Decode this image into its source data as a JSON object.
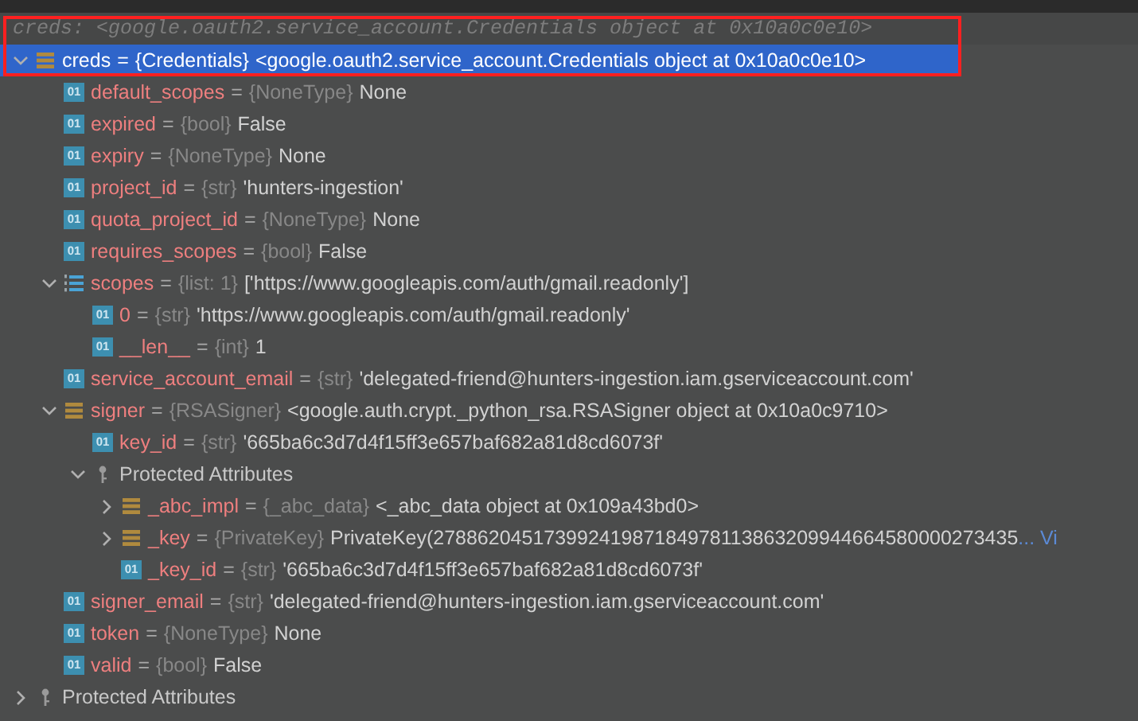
{
  "hint": "creds: <google.oauth2.service_account.Credentials object at 0x10a0c0e10>",
  "separator": "=",
  "tree": [
    {
      "kind": "object",
      "name": "creds",
      "type": "{Credentials}",
      "value": "<google.oauth2.service_account.Credentials object at 0x10a0c0e10>",
      "expanded": true,
      "selected": true,
      "children": [
        {
          "kind": "field",
          "badge": "01",
          "name": "default_scopes",
          "type": "{NoneType}",
          "value": "None",
          "selected": false
        },
        {
          "kind": "field",
          "badge": "01",
          "name": "expired",
          "type": "{bool}",
          "value": "False",
          "selected": false
        },
        {
          "kind": "field",
          "badge": "01",
          "name": "expiry",
          "type": "{NoneType}",
          "value": "None",
          "selected": false
        },
        {
          "kind": "field",
          "badge": "01",
          "name": "project_id",
          "type": "{str}",
          "value": "'hunters-ingestion'",
          "selected": false
        },
        {
          "kind": "field",
          "badge": "01",
          "name": "quota_project_id",
          "type": "{NoneType}",
          "value": "None",
          "selected": false
        },
        {
          "kind": "field",
          "badge": "01",
          "name": "requires_scopes",
          "type": "{bool}",
          "value": "False",
          "selected": false
        },
        {
          "kind": "list",
          "name": "scopes",
          "type": "{list: 1}",
          "value": "['https://www.googleapis.com/auth/gmail.readonly']",
          "expanded": true,
          "selected": false,
          "children": [
            {
              "kind": "field",
              "badge": "01",
              "name": "0",
              "type": "{str}",
              "value": "'https://www.googleapis.com/auth/gmail.readonly'",
              "selected": false
            },
            {
              "kind": "field",
              "badge": "01",
              "name": "__len__",
              "type": "{int}",
              "value": "1",
              "selected": false
            }
          ]
        },
        {
          "kind": "field",
          "badge": "01",
          "name": "service_account_email",
          "type": "{str}",
          "value": "'delegated-friend@hunters-ingestion.iam.gserviceaccount.com'",
          "selected": false
        },
        {
          "kind": "object",
          "name": "signer",
          "type": "{RSASigner}",
          "value": "<google.auth.crypt._python_rsa.RSASigner object at 0x10a0c9710>",
          "expanded": true,
          "selected": false,
          "children": [
            {
              "kind": "field",
              "badge": "01",
              "name": "key_id",
              "type": "{str}",
              "value": "'665ba6c3d7d4f15ff3e657baf682a81d8cd6073f'",
              "selected": false
            },
            {
              "kind": "group",
              "name": "Protected Attributes",
              "expanded": true,
              "selected": false,
              "children": [
                {
                  "kind": "object",
                  "name": "_abc_impl",
                  "type": "{_abc_data}",
                  "value": "<_abc_data object at 0x109a43bd0>",
                  "expanded": false,
                  "selected": false
                },
                {
                  "kind": "object",
                  "name": "_key",
                  "type": "{PrivateKey}",
                  "value": "PrivateKey(27886204517399241987184978113863209944664580000273435",
                  "link": "... Vi",
                  "expanded": false,
                  "selected": false
                },
                {
                  "kind": "field",
                  "badge": "01",
                  "name": "_key_id",
                  "type": "{str}",
                  "value": "'665ba6c3d7d4f15ff3e657baf682a81d8cd6073f'",
                  "selected": false
                }
              ]
            }
          ]
        },
        {
          "kind": "field",
          "badge": "01",
          "name": "signer_email",
          "type": "{str}",
          "value": "'delegated-friend@hunters-ingestion.iam.gserviceaccount.com'",
          "selected": false
        },
        {
          "kind": "field",
          "badge": "01",
          "name": "token",
          "type": "{NoneType}",
          "value": "None",
          "selected": false
        },
        {
          "kind": "field",
          "badge": "01",
          "name": "valid",
          "type": "{bool}",
          "value": "False",
          "selected": false
        }
      ]
    },
    {
      "kind": "group",
      "name": "Protected Attributes",
      "expanded": false,
      "selected": false
    }
  ]
}
